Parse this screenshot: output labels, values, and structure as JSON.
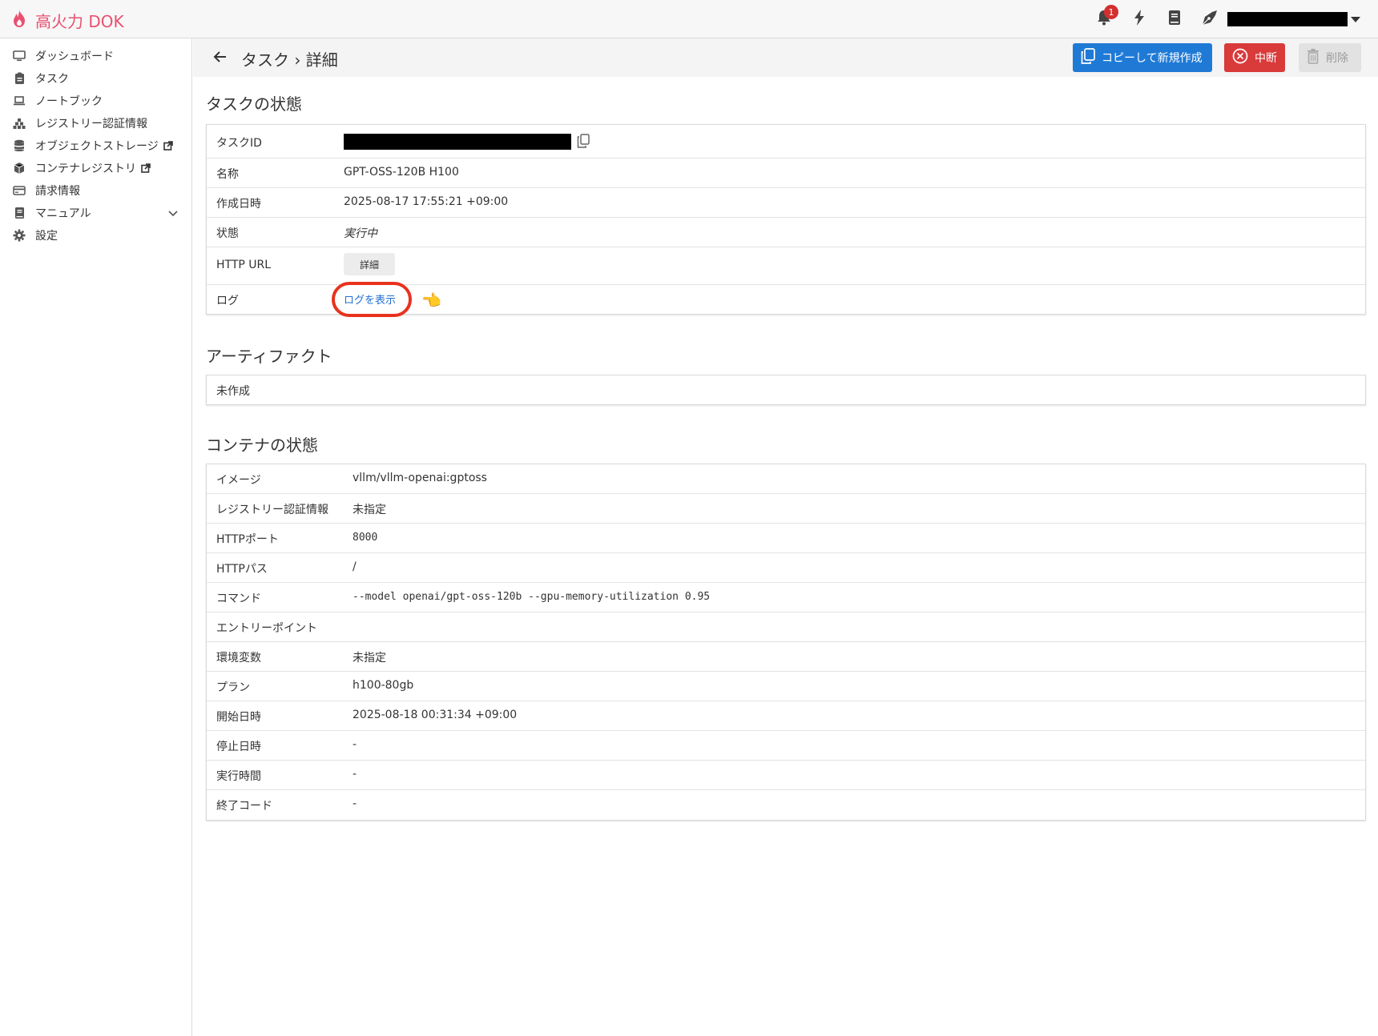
{
  "app": {
    "brand": "高火力 DOK"
  },
  "topbar": {
    "notification_count": "1"
  },
  "sidebar": {
    "items": [
      {
        "label": "ダッシュボード",
        "icon": "monitor-icon"
      },
      {
        "label": "タスク",
        "icon": "clipboard-icon"
      },
      {
        "label": "ノートブック",
        "icon": "laptop-icon"
      },
      {
        "label": "レジストリー認証情報",
        "icon": "cubes-icon"
      },
      {
        "label": "オブジェクトストレージ",
        "icon": "database-icon",
        "external": true
      },
      {
        "label": "コンテナレジストリ",
        "icon": "box-icon",
        "external": true
      },
      {
        "label": "請求情報",
        "icon": "credit-card-icon"
      },
      {
        "label": "マニュアル",
        "icon": "book-icon",
        "expandable": true
      },
      {
        "label": "設定",
        "icon": "gear-icon"
      }
    ]
  },
  "header": {
    "breadcrumb": "タスク › 詳細",
    "copy_button": "コピーして新規作成",
    "stop_button": "中断",
    "delete_button": "削除"
  },
  "task_status": {
    "title": "タスクの状態",
    "rows": {
      "id_label": "タスクID",
      "name_label": "名称",
      "name_value": "GPT-OSS-120B H100",
      "created_label": "作成日時",
      "created_value": "2025-08-17 17:55:21 +09:00",
      "state_label": "状態",
      "state_value": "実行中",
      "http_label": "HTTP URL",
      "http_button": "詳細",
      "log_label": "ログ",
      "log_link": "ログを表示"
    }
  },
  "artifact": {
    "title": "アーティファクト",
    "value": "未作成"
  },
  "container": {
    "title": "コンテナの状態",
    "rows": [
      {
        "label": "イメージ",
        "value": "vllm/vllm-openai:gptoss",
        "mono": false
      },
      {
        "label": "レジストリー認証情報",
        "value": "未指定",
        "mono": false
      },
      {
        "label": "HTTPポート",
        "value": "8000",
        "mono": true
      },
      {
        "label": "HTTPパス",
        "value": "/",
        "mono": false
      },
      {
        "label": "コマンド",
        "value": "--model openai/gpt-oss-120b --gpu-memory-utilization 0.95",
        "mono": true
      },
      {
        "label": "エントリーポイント",
        "value": "",
        "mono": false
      },
      {
        "label": "環境変数",
        "value": "未指定",
        "mono": false
      },
      {
        "label": "プラン",
        "value": "h100-80gb",
        "mono": false
      },
      {
        "label": "開始日時",
        "value": "2025-08-18 00:31:34 +09:00",
        "mono": false
      },
      {
        "label": "停止日時",
        "value": "-",
        "mono": false
      },
      {
        "label": "実行時間",
        "value": "-",
        "mono": false
      },
      {
        "label": "終了コード",
        "value": "-",
        "mono": false
      }
    ]
  },
  "colors": {
    "brand": "#e8506f",
    "primary": "#1f7ad6",
    "danger": "#d93a3a",
    "link": "#1f6fd1",
    "highlight": "#e8321e"
  }
}
